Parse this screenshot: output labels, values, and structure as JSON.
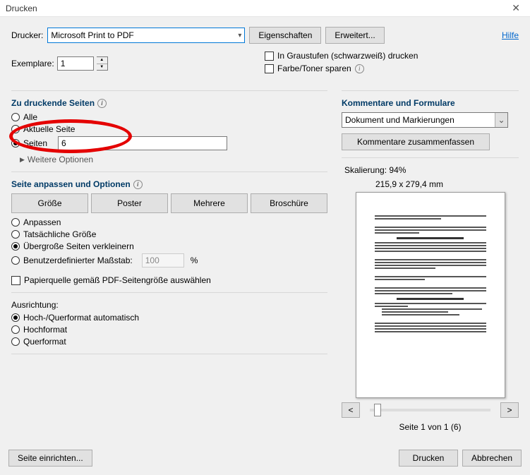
{
  "window": {
    "title": "Drucken"
  },
  "help_link": "Hilfe",
  "printer": {
    "label": "Drucker:",
    "selected": "Microsoft Print to PDF",
    "properties": "Eigenschaften",
    "advanced": "Erweitert..."
  },
  "copies": {
    "label": "Exemplare:",
    "value": "1"
  },
  "grayscale": {
    "label": "In Graustufen (schwarzweiß) drucken"
  },
  "savetoner": {
    "label": "Farbe/Toner sparen"
  },
  "pages_group": {
    "title": "Zu druckende Seiten",
    "all": "Alle",
    "current": "Aktuelle Seite",
    "pages": "Seiten",
    "pages_value": "6",
    "more": "Weitere Optionen"
  },
  "fit_group": {
    "title": "Seite anpassen und Optionen",
    "size": "Größe",
    "poster": "Poster",
    "multiple": "Mehrere",
    "booklet": "Broschüre",
    "fit": "Anpassen",
    "actual": "Tatsächliche Größe",
    "shrink": "Übergroße Seiten verkleinern",
    "custom": "Benutzerdefinierter Maßstab:",
    "custom_value": "100",
    "custom_unit": "%",
    "paper_source": "Papierquelle gemäß PDF-Seitengröße auswählen"
  },
  "orient": {
    "title": "Ausrichtung:",
    "auto": "Hoch-/Querformat automatisch",
    "portrait": "Hochformat",
    "landscape": "Querformat"
  },
  "comments": {
    "title": "Kommentare und Formulare",
    "selected": "Dokument und Markierungen",
    "summarize": "Kommentare zusammenfassen"
  },
  "preview": {
    "scaling_label": "Skalierung:",
    "scaling_value": "94%",
    "dimensions": "215,9 x 279,4 mm",
    "prev": "<",
    "next": ">",
    "page_info": "Seite 1 von 1 (6)"
  },
  "footer": {
    "page_setup": "Seite einrichten...",
    "print": "Drucken",
    "cancel": "Abbrechen"
  }
}
